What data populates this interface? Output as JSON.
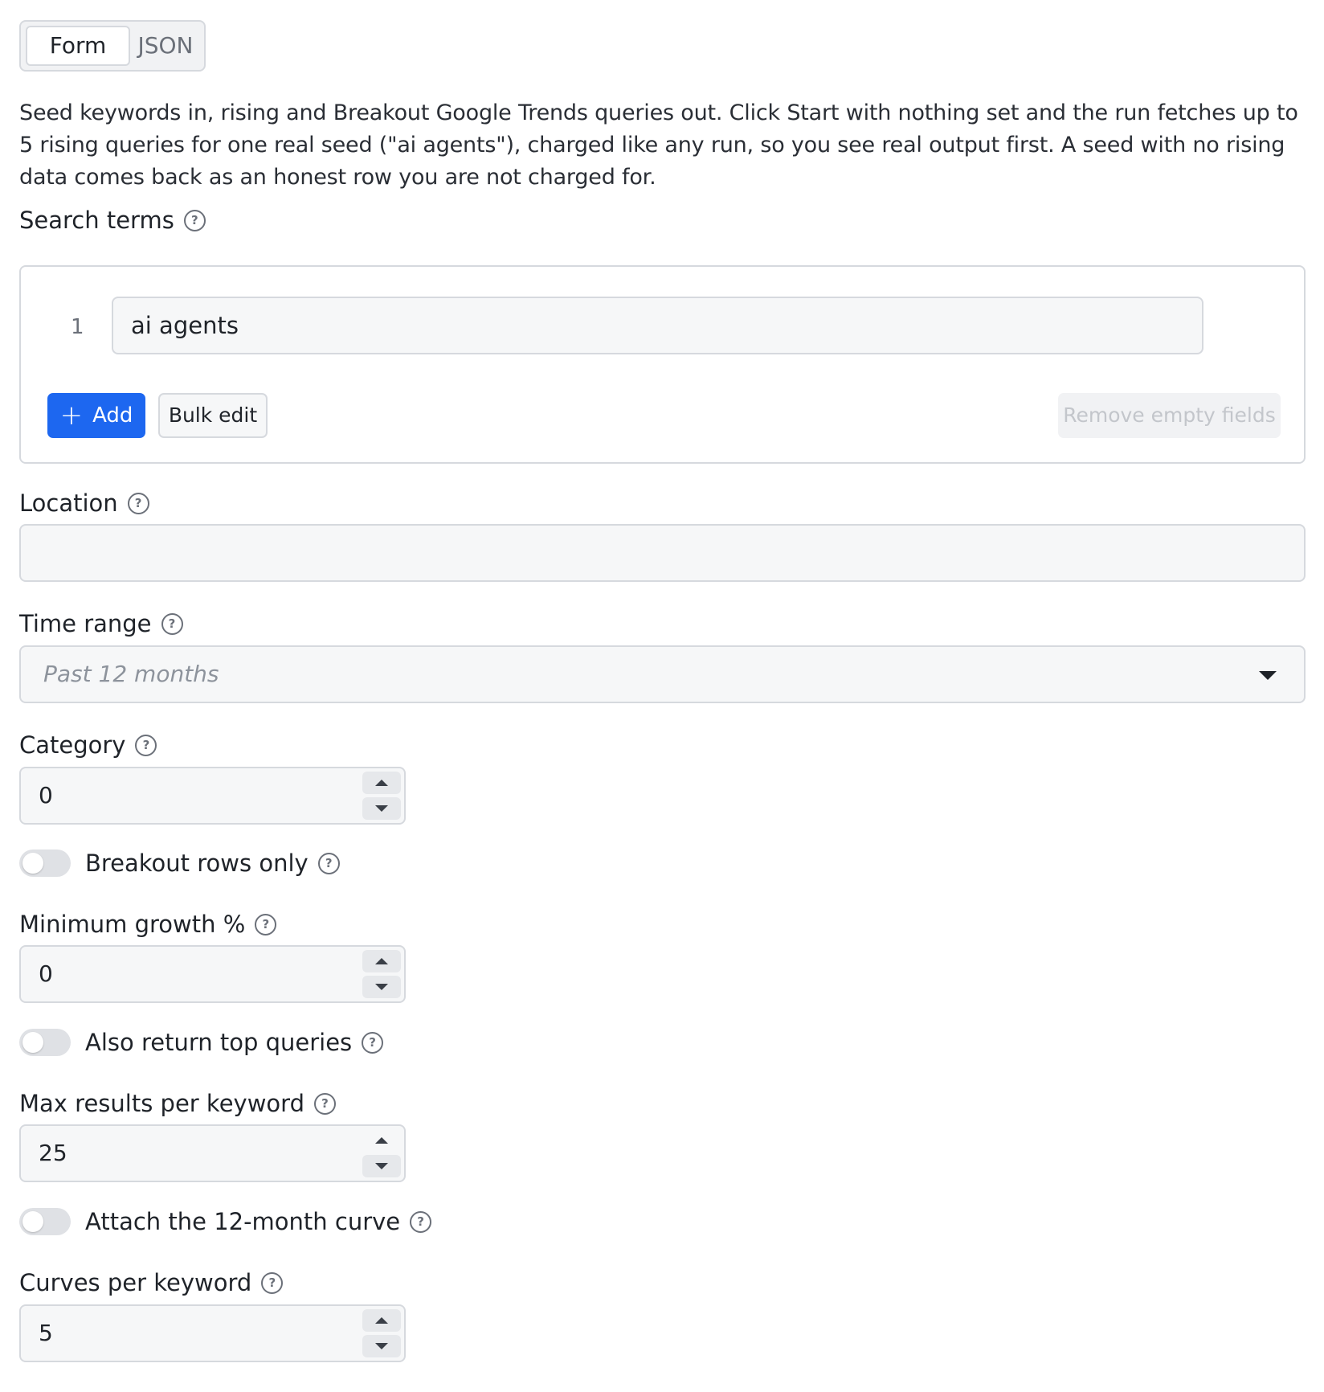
{
  "tabs": {
    "form": "Form",
    "json": "JSON"
  },
  "description": "Seed keywords in, rising and Breakout Google Trends queries out. Click Start with nothing set and the run fetches up to 5 rising queries for one real seed (\"ai agents\"), charged like any run, so you see real output first. A seed with no rising data comes back as an honest row you are not charged for.",
  "search_terms": {
    "label": "Search terms",
    "rows": [
      {
        "index": "1",
        "value": "ai agents"
      }
    ],
    "add_label": "Add",
    "bulk_edit_label": "Bulk edit",
    "remove_empty_label": "Remove empty fields"
  },
  "location": {
    "label": "Location",
    "value": ""
  },
  "time_range": {
    "label": "Time range",
    "placeholder": "Past 12 months"
  },
  "category": {
    "label": "Category",
    "value": "0"
  },
  "breakout_only": {
    "label": "Breakout rows only",
    "enabled": false
  },
  "min_growth": {
    "label": "Minimum growth %",
    "value": "0"
  },
  "top_queries": {
    "label": "Also return top queries",
    "enabled": false
  },
  "max_results": {
    "label": "Max results per keyword",
    "value": "25"
  },
  "attach_curve": {
    "label": "Attach the 12-month curve",
    "enabled": false
  },
  "curves_per_keyword": {
    "label": "Curves per keyword",
    "value": "5"
  },
  "colors": {
    "primary": "#1d67f0",
    "border": "#d6d9de",
    "input_bg": "#f6f7f8"
  }
}
